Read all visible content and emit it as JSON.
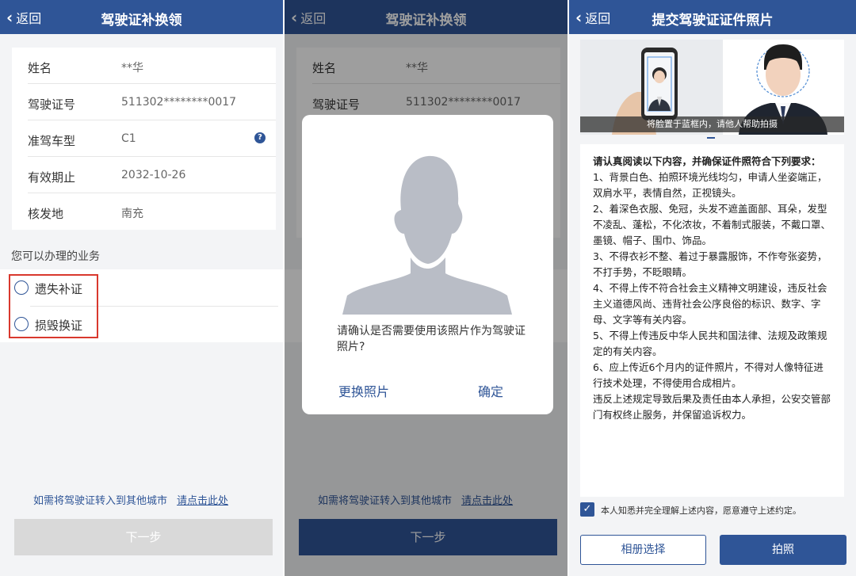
{
  "panel1": {
    "nav": {
      "back": "返回",
      "title": "驾驶证补换领"
    },
    "info": [
      {
        "label": "姓名",
        "value": "**华"
      },
      {
        "label": "驾驶证号",
        "value": "511302********0017"
      },
      {
        "label": "准驾车型",
        "value": "C1"
      },
      {
        "label": "有效期止",
        "value": "2032-10-26"
      },
      {
        "label": "核发地",
        "value": "南充"
      }
    ],
    "help_icon": "question-mark-icon",
    "section_title": "您可以办理的业务",
    "options": [
      "遗失补证",
      "损毁换证"
    ],
    "transfer_text": "如需将驾驶证转入到其他城市",
    "transfer_link": "请点击此处",
    "next": "下一步"
  },
  "panel2": {
    "nav": {
      "back": "返回",
      "title": "驾驶证补换领"
    },
    "info": [
      {
        "label": "姓名",
        "value": "**华"
      },
      {
        "label": "驾驶证号",
        "value": "511302********0017"
      }
    ],
    "dialog": {
      "message": "请确认是否需要使用该照片作为驾驶证照片?",
      "change": "更换照片",
      "confirm": "确定"
    },
    "transfer_text": "如需将驾驶证转入到其他城市",
    "transfer_link": "请点击此处",
    "next": "下一步"
  },
  "panel3": {
    "nav": {
      "back": "返回",
      "title": "提交驾驶证证件照片"
    },
    "photo_caption": "将脸置于蓝框内，请他人帮助拍摄",
    "requirements": [
      "请认真阅读以下内容，并确保证件照符合下列要求：",
      "1、背景白色、拍照环境光线均匀，申请人坐姿端正，双肩水平，表情自然，正视镜头。",
      "2、着深色衣服、免冠，头发不遮盖面部、耳朵，发型不凌乱、蓬松，不化浓妆，不着制式服装，不戴口罩、墨镜、帽子、围巾、饰品。",
      "3、不得衣衫不整、着过于暴露服饰，不作夸张姿势，不打手势，不眨眼睛。",
      "4、不得上传不符合社会主义精神文明建设，违反社会主义道德风尚、违背社会公序良俗的标识、数字、字母、文字等有关内容。",
      "5、不得上传违反中华人民共和国法律、法规及政策规定的有关内容。",
      "6、应上传近6个月内的证件照片，不得对人像特征进行技术处理，不得使用合成相片。",
      "违反上述规定导致后果及责任由本人承担，公安交管部门有权终止服务，并保留追诉权力。"
    ],
    "agree_text": "本人知悉并完全理解上述内容，愿意遵守上述约定。",
    "album": "相册选择",
    "shoot": "拍照"
  },
  "colors": {
    "primary": "#2f5597",
    "highlight": "#d9382d"
  }
}
